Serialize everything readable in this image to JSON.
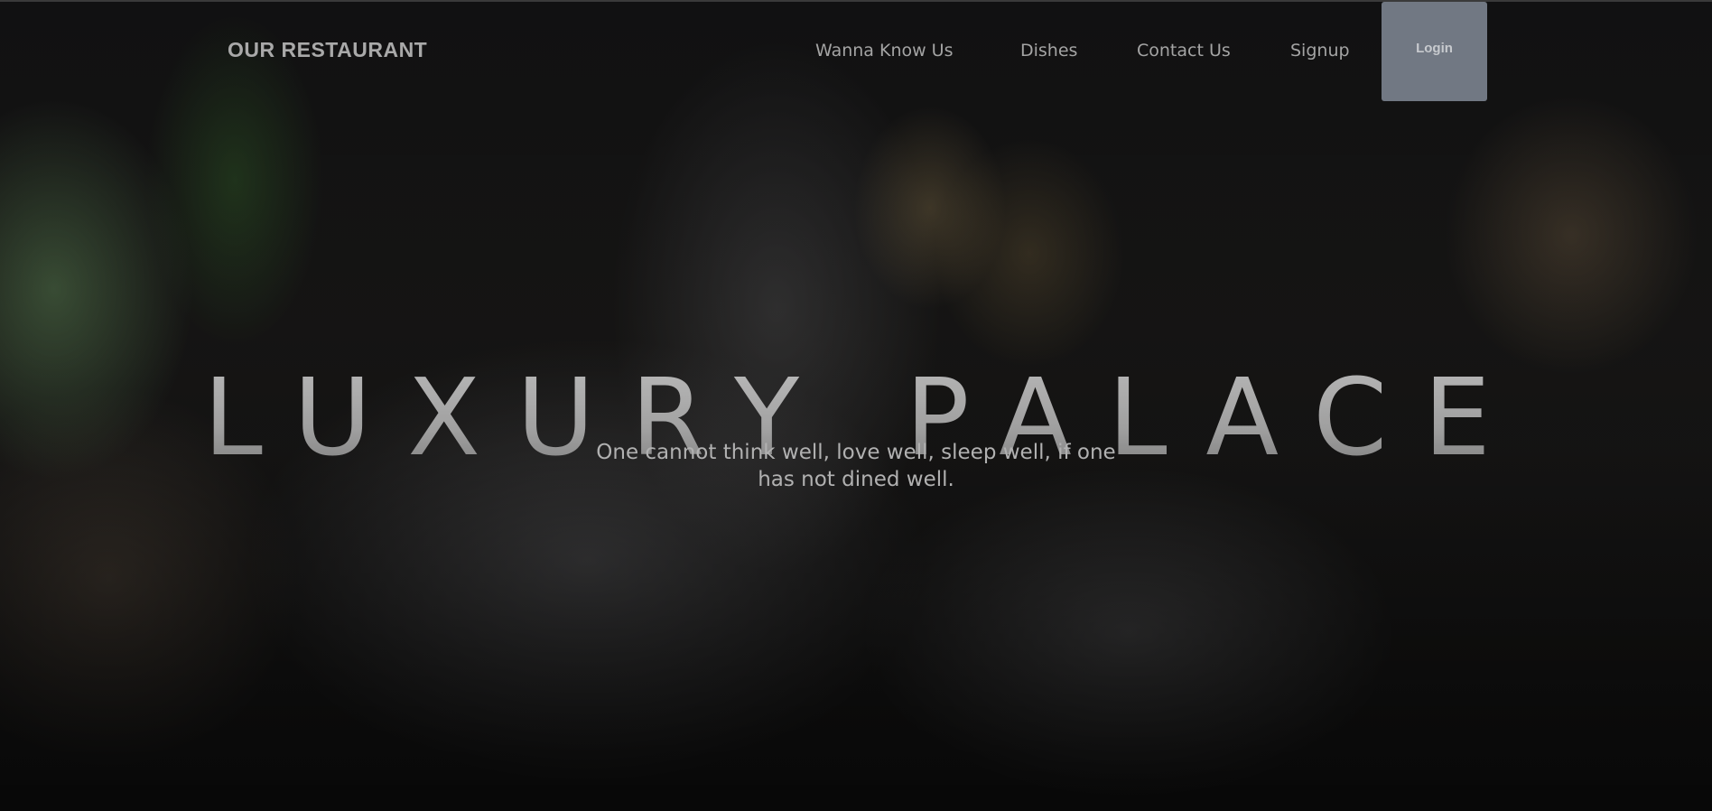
{
  "nav": {
    "brand": "OUR RESTAURANT",
    "links": [
      "Wanna Know Us",
      "Dishes",
      "Contact Us",
      "Signup"
    ],
    "login_label": "Login"
  },
  "hero": {
    "title": "LUXURY PALACE",
    "subtitle": "One cannot think well, love well, sleep well, if one has not dined well."
  },
  "colors": {
    "login_button_bg": "#717883",
    "nav_text": "#a4a4a4"
  }
}
